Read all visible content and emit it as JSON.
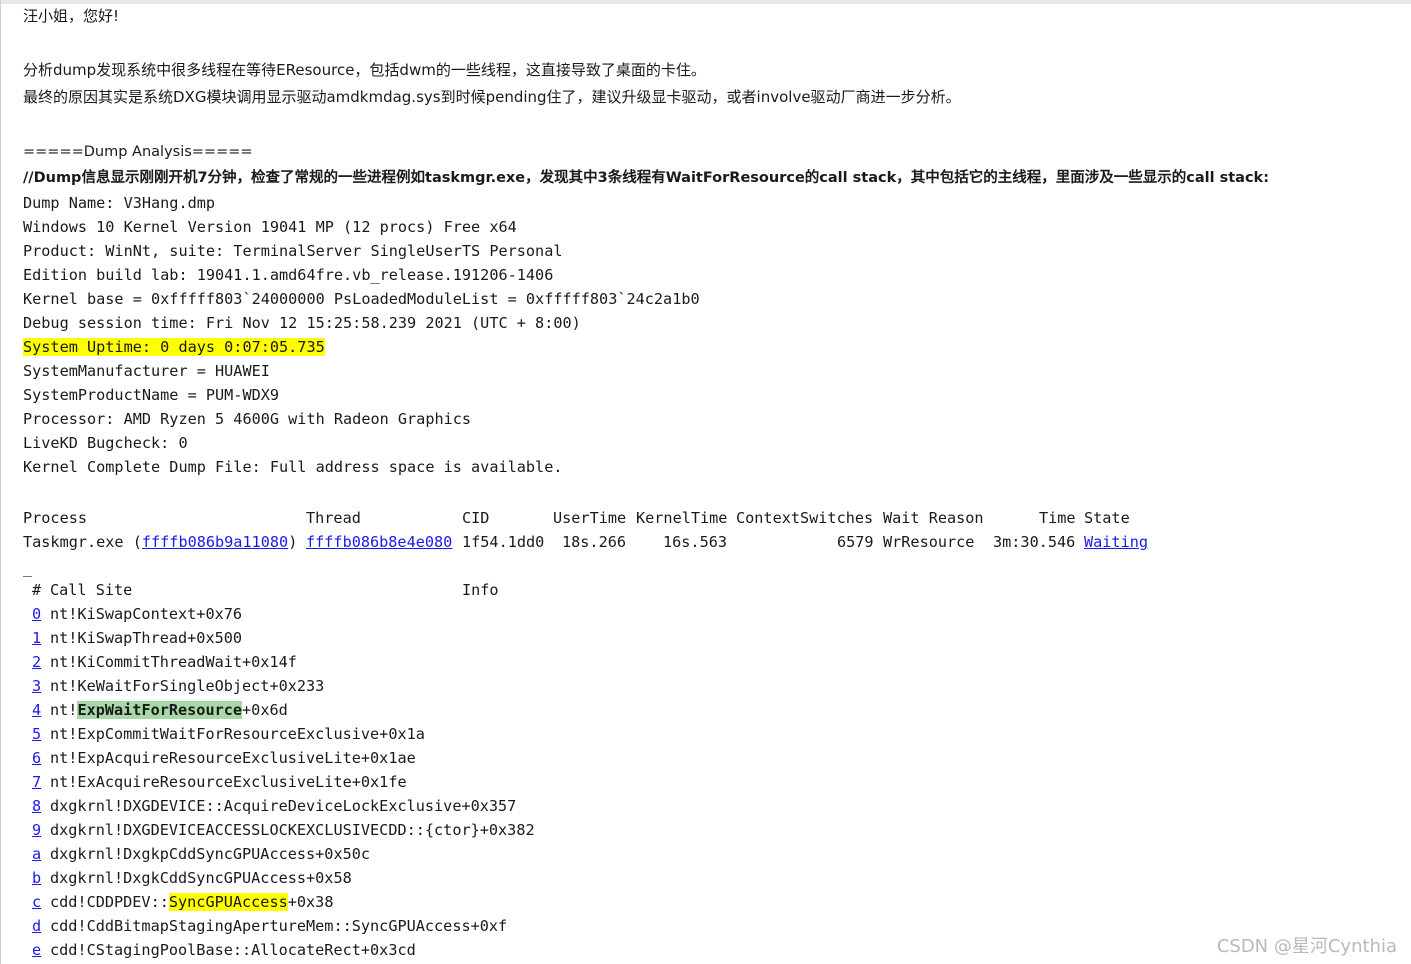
{
  "greeting": "汪小姐，您好!",
  "para1": "分析dump发现系统中很多线程在等待EResource，包括dwm的一些线程，这直接导致了桌面的卡住。",
  "para2": "最终的原因其实是系统DXG模块调用显示驱动amdkmdag.sys到时候pending住了，建议升级显卡驱动，或者involve驱动厂商进一步分析。",
  "dump_header": "=====Dump Analysis=====",
  "dump_note": "//Dump信息显示刚刚开机7分钟，检查了常规的一些进程例如taskmgr.exe，发现其中3条线程有WaitForResource的call stack，其中包括它的主线程，里面涉及一些显示的call stack:",
  "info_lines": [
    "Dump Name: V3Hang.dmp",
    "Windows 10 Kernel Version 19041 MP (12 procs) Free x64",
    "Product: WinNt, suite: TerminalServer SingleUserTS Personal",
    "Edition build lab: 19041.1.amd64fre.vb_release.191206-1406",
    "Kernel base = 0xfffff803`24000000 PsLoadedModuleList = 0xfffff803`24c2a1b0",
    "Debug session time: Fri Nov 12 15:25:58.239 2021 (UTC + 8:00)"
  ],
  "uptime": "System Uptime: 0 days 0:07:05.735",
  "info_lines2": [
    "SystemManufacturer = HUAWEI",
    "SystemProductName = PUM-WDX9",
    "Processor: AMD Ryzen 5 4600G with Radeon Graphics",
    "LiveKD Bugcheck: 0",
    "Kernel Complete Dump File: Full address space is available."
  ],
  "process_table": {
    "headers": {
      "process": "Process",
      "thread": "Thread",
      "cid": "CID",
      "usertime": "UserTime",
      "kerneltime": "KernelTime",
      "contextswitches": "ContextSwitches",
      "waitreason": "Wait Reason",
      "time": "Time",
      "state": "State"
    },
    "row": {
      "process_name": "Taskmgr.exe (",
      "process_link": "ffffb086b9a11080",
      "process_close": ")",
      "thread_link": "ffffb086b8e4e080",
      "cid": "1f54.1dd0",
      "usertime": "18s.266",
      "kerneltime": "16s.563",
      "contextswitches": "6579",
      "waitreason": "WrResource",
      "time": "3m:30.546",
      "state_link": "Waiting"
    }
  },
  "underscore": "_",
  "callstack_header": {
    "num": "#",
    "callsite": "Call Site",
    "info": "Info"
  },
  "frames": [
    {
      "num": "0",
      "site": "nt!KiSwapContext+0x76"
    },
    {
      "num": "1",
      "site": "nt!KiSwapThread+0x500"
    },
    {
      "num": "2",
      "site": "nt!KiCommitThreadWait+0x14f"
    },
    {
      "num": "3",
      "site": "nt!KeWaitForSingleObject+0x233"
    },
    {
      "num": "4",
      "site_pre": "nt!",
      "site_hl": "ExpWaitForResource",
      "site_post": "+0x6d"
    },
    {
      "num": "5",
      "site": "nt!ExpCommitWaitForResourceExclusive+0x1a"
    },
    {
      "num": "6",
      "site": "nt!ExpAcquireResourceExclusiveLite+0x1ae"
    },
    {
      "num": "7",
      "site": "nt!ExAcquireResourceExclusiveLite+0x1fe"
    },
    {
      "num": "8",
      "site": "dxgkrnl!DXGDEVICE::AcquireDeviceLockExclusive+0x357"
    },
    {
      "num": "9",
      "site": "dxgkrnl!DXGDEVICEACCESSLOCKEXCLUSIVECDD::{ctor}+0x382"
    },
    {
      "num": "a",
      "site": "dxgkrnl!DxgkpCddSyncGPUAccess+0x50c"
    },
    {
      "num": "b",
      "site": "dxgkrnl!DxgkCddSyncGPUAccess+0x58"
    },
    {
      "num": "c",
      "site_pre": "cdd!CDDPDEV::",
      "site_hl": "SyncGPUAccess",
      "site_post": "+0x38"
    },
    {
      "num": "d",
      "site": "cdd!CddBitmapStagingApertureMem::SyncGPUAccess+0xf"
    },
    {
      "num": "e",
      "site": "cdd!CStagingPoolBase::AllocateRect+0x3cd"
    }
  ],
  "watermark": "CSDN @星河Cynthia",
  "colors": {
    "highlight_yellow": "#ffff00",
    "highlight_green": "#a8d8a8",
    "link": "#1a1aee",
    "text": "#1a1a1a"
  }
}
